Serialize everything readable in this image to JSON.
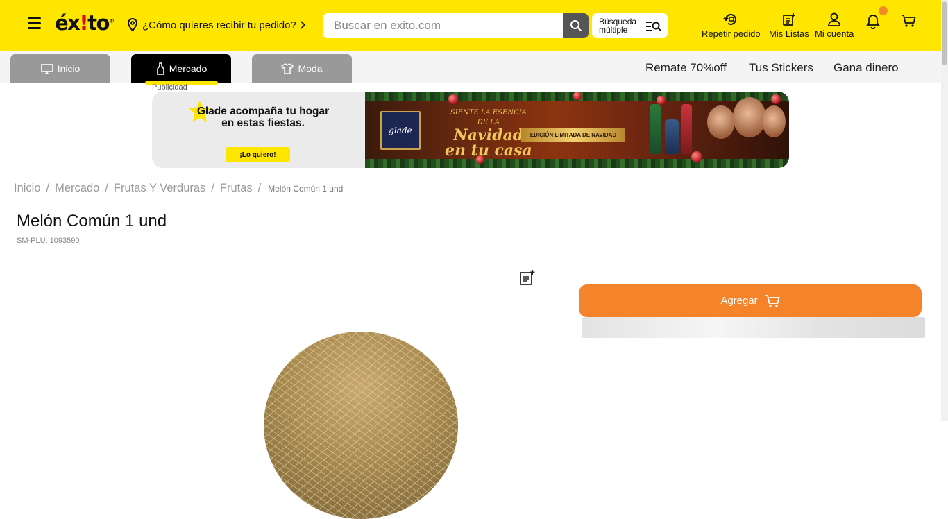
{
  "header": {
    "logo_text": "éxito",
    "delivery_prompt": "¿Cómo quieres recibir tu pedido?",
    "search_placeholder": "Buscar en exito.com",
    "multi_search_line1": "Búsqueda",
    "multi_search_line2": "múltiple",
    "repeat_order": "Repetir pedido",
    "my_lists": "Mis Listas",
    "my_account": "Mi cuenta"
  },
  "nav": {
    "tabs": [
      {
        "label": "Inicio"
      },
      {
        "label": "Mercado"
      },
      {
        "label": "Moda"
      }
    ],
    "links": [
      "Remate 70%off",
      "Tus Stickers",
      "Gana dinero"
    ]
  },
  "ad": {
    "label": "Publicidad",
    "headline": "Glade acompaña tu hogar en estas fiestas.",
    "cta": "¡Lo quiero!",
    "brand": "glade",
    "tag_small_1": "SIENTE LA ESENCIA",
    "tag_small_2": "DE LA",
    "tag_big_1": "Navidad",
    "tag_big_2": "en tu casa",
    "ribbon": "EDICIÓN LIMITADA DE NAVIDAD"
  },
  "breadcrumb": [
    "Inicio",
    "Mercado",
    "Frutas Y Verduras",
    "Frutas",
    "Melón Común 1 und"
  ],
  "product": {
    "title": "Melón Común 1 und",
    "plu": "SM-PLU: 1093590",
    "add_button": "Agregar"
  },
  "colors": {
    "brand_yellow": "#ffe600",
    "cta_orange": "#f5832a",
    "active_tab": "#000000",
    "inactive_tab": "#999999"
  }
}
